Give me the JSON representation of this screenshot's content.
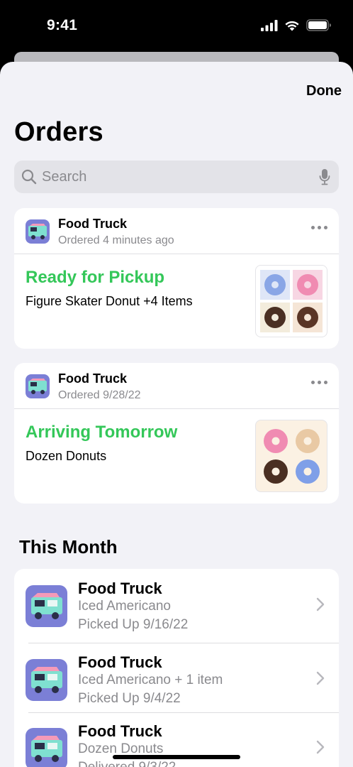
{
  "status_bar": {
    "time": "9:41"
  },
  "header": {
    "done_label": "Done",
    "title": "Orders"
  },
  "search": {
    "placeholder": "Search"
  },
  "active_orders": [
    {
      "merchant": "Food Truck",
      "ordered": "Ordered 4 minutes ago",
      "status": "Ready for Pickup",
      "items": "Figure Skater Donut +4 Items"
    },
    {
      "merchant": "Food Truck",
      "ordered": "Ordered 9/28/22",
      "status": "Arriving Tomorrow",
      "items": "Dozen Donuts"
    }
  ],
  "history": {
    "section_title": "This Month",
    "rows": [
      {
        "merchant": "Food Truck",
        "item": "Iced Americano",
        "status": "Picked Up 9/16/22"
      },
      {
        "merchant": "Food Truck",
        "item": "Iced Americano + 1 item",
        "status": "Picked Up 9/4/22"
      },
      {
        "merchant": "Food Truck",
        "item": "Dozen Donuts",
        "status": "Delivered 9/3/22"
      }
    ]
  },
  "colors": {
    "status_green": "#34c759",
    "app_icon_purple": "#7b7fd6",
    "sheet_bg": "#f2f2f7"
  }
}
